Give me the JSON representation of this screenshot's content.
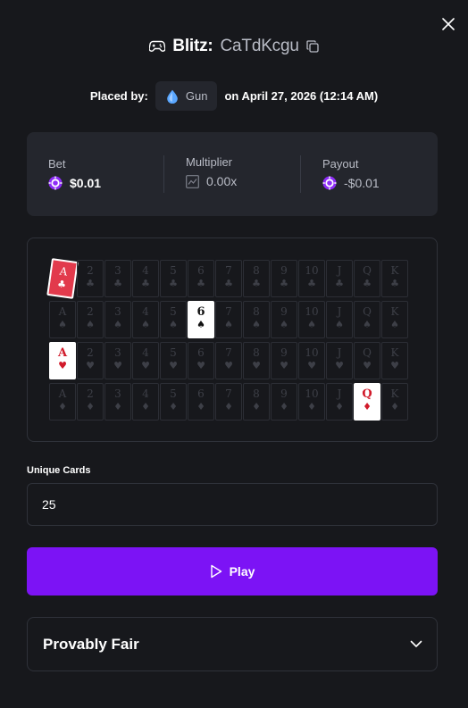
{
  "header": {
    "title": "Blitz:",
    "game_id": "CaTdKcgu",
    "game_icon": "gamepad-icon",
    "copy_icon": "copy-icon",
    "close_icon": "close-icon"
  },
  "placed": {
    "label": "Placed by:",
    "username": "Gun",
    "avatar_icon": "droplet-icon",
    "date_text": "on April 27, 2026 (12:14 AM)"
  },
  "stats": {
    "bet_label": "Bet",
    "bet_value": "$0.01",
    "multiplier_label": "Multiplier",
    "multiplier_value": "0.00x",
    "payout_label": "Payout",
    "payout_value": "-$0.01"
  },
  "board": {
    "ranks": [
      "A",
      "2",
      "3",
      "4",
      "5",
      "6",
      "7",
      "8",
      "9",
      "10",
      "J",
      "Q",
      "K"
    ],
    "rows": [
      {
        "suit": "clubs",
        "symbol": "♣",
        "color": "black"
      },
      {
        "suit": "spades",
        "symbol": "♠",
        "color": "black"
      },
      {
        "suit": "hearts",
        "symbol": "♥",
        "color": "red"
      },
      {
        "suit": "diamonds",
        "symbol": "♦",
        "color": "red"
      }
    ],
    "highlighted": [
      {
        "row": 0,
        "col": 0,
        "style": "drawn"
      },
      {
        "row": 1,
        "col": 5,
        "style": "on"
      },
      {
        "row": 2,
        "col": 0,
        "style": "on"
      },
      {
        "row": 3,
        "col": 11,
        "style": "on"
      }
    ]
  },
  "unique_cards": {
    "label": "Unique Cards",
    "value": "25"
  },
  "play_button": {
    "label": "Play",
    "icon": "play-icon"
  },
  "provably_fair": {
    "title": "Provably Fair",
    "icon": "chevron-down-icon"
  },
  "colors": {
    "background": "#17181c",
    "panel": "#24262d",
    "accent": "#7c13f5",
    "muted_text": "#b9bcc6"
  }
}
